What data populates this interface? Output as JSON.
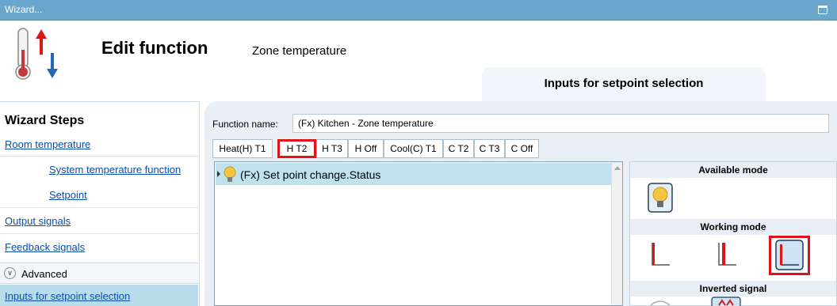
{
  "window": {
    "title": "Wizard..."
  },
  "header": {
    "title": "Edit function",
    "subtitle": "Zone temperature",
    "current_step_tab": "Inputs for setpoint selection"
  },
  "wizard_steps": {
    "title": "Wizard Steps",
    "room_temperature": "Room temperature",
    "system_temperature_function": "System temperature function",
    "setpoint": "Setpoint",
    "output_signals": "Output signals",
    "feedback_signals": "Feedback signals",
    "advanced": "Advanced",
    "inputs_for_setpoint_selection": "Inputs for setpoint selection"
  },
  "function": {
    "name_label": "Function name:",
    "name_value": "(Fx) Kitchen - Zone temperature"
  },
  "tabs": [
    {
      "label": "Heat(H) T1"
    },
    {
      "label": "H T2"
    },
    {
      "label": "H T3"
    },
    {
      "label": "H Off"
    },
    {
      "label": "Cool(C) T1"
    },
    {
      "label": "C T2"
    },
    {
      "label": "C T3"
    },
    {
      "label": "C Off"
    }
  ],
  "active_tab": "H T2",
  "inputs_list": [
    {
      "label": "(Fx) Set point change.Status",
      "icon": "bulb-icon"
    }
  ],
  "modes": {
    "available_mode_title": "Available mode",
    "working_mode_title": "Working mode",
    "inverted_signal_title": "Inverted signal",
    "selected_working_mode": 3
  },
  "colors": {
    "titlebar": "#6aa5cc",
    "highlight_red": "#e2121b",
    "link_blue": "#0b4ea8",
    "selected_row": "#b9dceb"
  }
}
